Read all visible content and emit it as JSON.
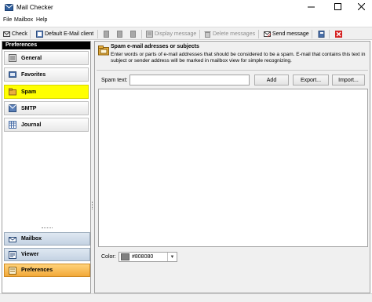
{
  "window": {
    "title": "Mail Checker",
    "app_icon": "mail-envelope-icon",
    "controls": [
      "minimize-icon",
      "maximize-icon",
      "close-icon"
    ]
  },
  "menu": {
    "items": [
      "File",
      "Mailbox",
      "Help"
    ]
  },
  "toolbar": {
    "check": "Check",
    "default_client": "Default E-Mail client",
    "display_message": "Display message",
    "delete_messages": "Delete messages",
    "send_message": "Send message"
  },
  "sidebar": {
    "header": "Preferences",
    "items": [
      {
        "label": "General",
        "icon": "general-settings-icon"
      },
      {
        "label": "Favorites",
        "icon": "favorites-icon"
      },
      {
        "label": "Spam",
        "icon": "spam-folder-icon"
      },
      {
        "label": "SMTP",
        "icon": "smtp-server-icon"
      },
      {
        "label": "Journal",
        "icon": "journal-icon"
      }
    ],
    "selected": "Spam",
    "bottom_buttons": [
      {
        "label": "Mailbox",
        "icon": "mailbox-icon"
      },
      {
        "label": "Viewer",
        "icon": "viewer-icon"
      },
      {
        "label": "Preferences",
        "icon": "preferences-icon"
      }
    ],
    "active_bottom": "Preferences"
  },
  "panel": {
    "title": "Spam e-mail adresses or subjects",
    "description": "Enter words or parts of e-mail addresses that should be considered to be a spam. E-mail that contains this text in subject or sender address will be marked in mailbox view for simple recognizing.",
    "spam_text_label": "Spam text:",
    "spam_text_value": "",
    "add_button": "Add",
    "export_button": "Export...",
    "import_button": "Import...",
    "color_label": "Color:",
    "color_value": "#808080"
  },
  "colors": {
    "selected_item": "#ffff00",
    "active_bottom": "#f2a93a",
    "swatch": "#808080"
  }
}
